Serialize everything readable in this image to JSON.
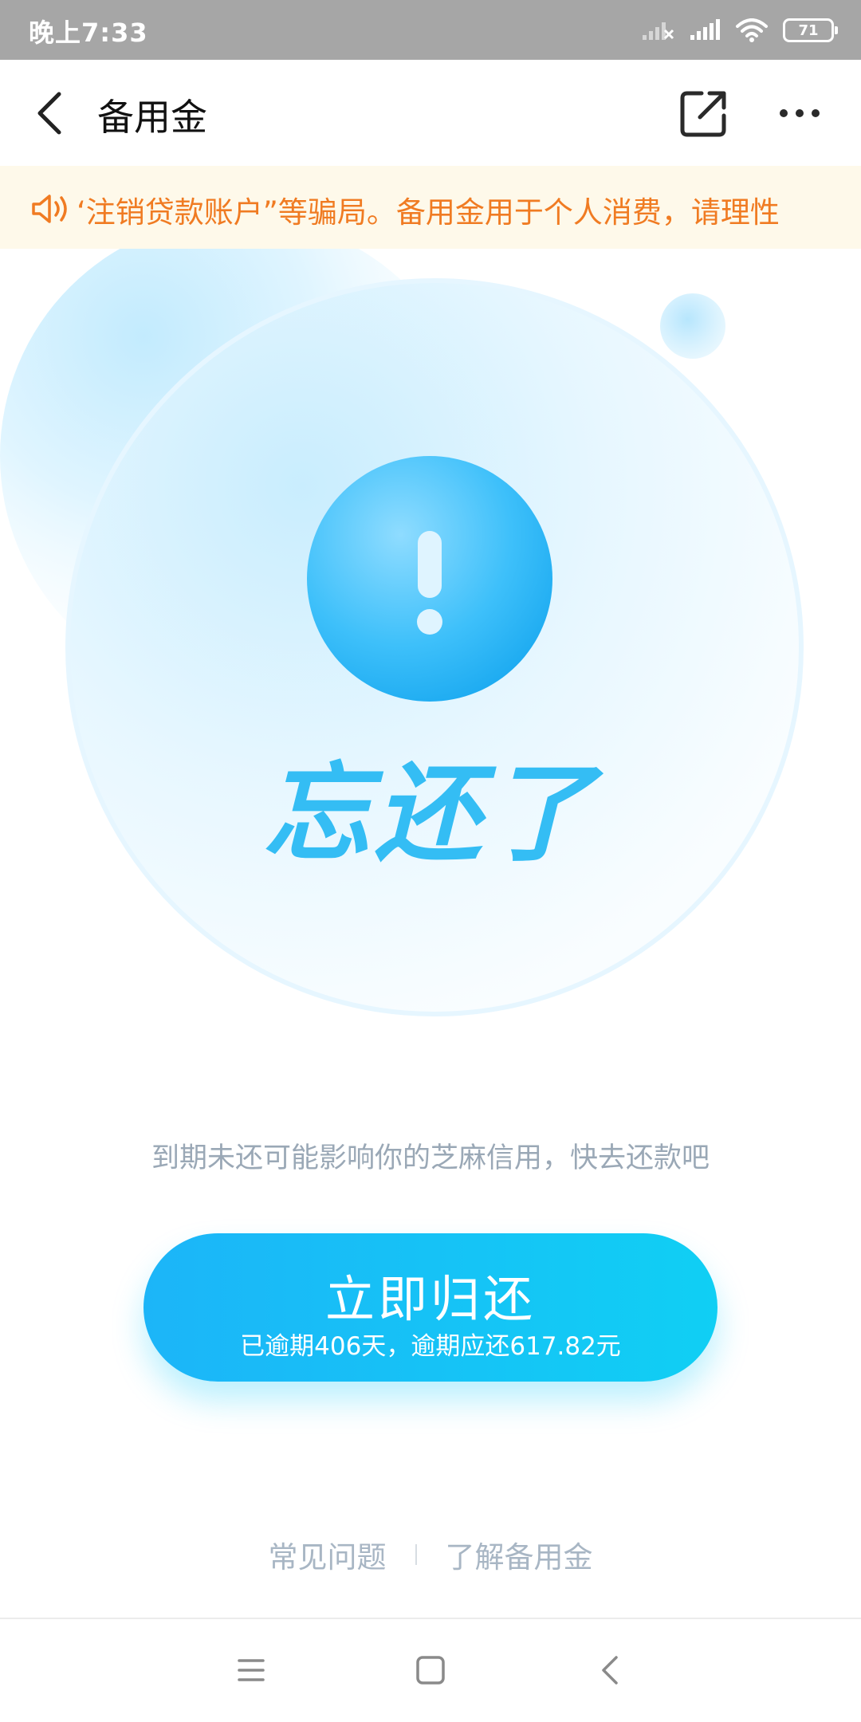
{
  "status_bar": {
    "time": "晚上7:33",
    "battery": "71",
    "icons": [
      "signal-x-icon",
      "signal-icon",
      "wifi-icon",
      "battery-icon"
    ]
  },
  "header": {
    "title": "备用金",
    "icons": [
      "back-arrow-icon",
      "share-icon",
      "more-icon"
    ]
  },
  "notice": {
    "icon": "speaker-icon",
    "text": "‘注销贷款账户”等骗局。备用金用于个人消费，请理性"
  },
  "hero": {
    "icon": "exclamation-icon",
    "title": "忘还了"
  },
  "hint": "到期未还可能影响你的芝麻信用，快去还款吧",
  "repay_button": {
    "label": "立即归还",
    "sub": "已逾期406天，逾期应还617.82元"
  },
  "footer_links": {
    "faq": "常见问题",
    "about": "了解备用金"
  },
  "system_nav": {
    "icons": [
      "menu-icon",
      "home-icon",
      "back-icon"
    ]
  },
  "colors": {
    "accent": "#1cb5f8",
    "notice_text": "#f07b22",
    "notice_bg": "#fef9ea",
    "status_bar": "#a6a6a6",
    "hint_text": "#9aa8b6"
  }
}
